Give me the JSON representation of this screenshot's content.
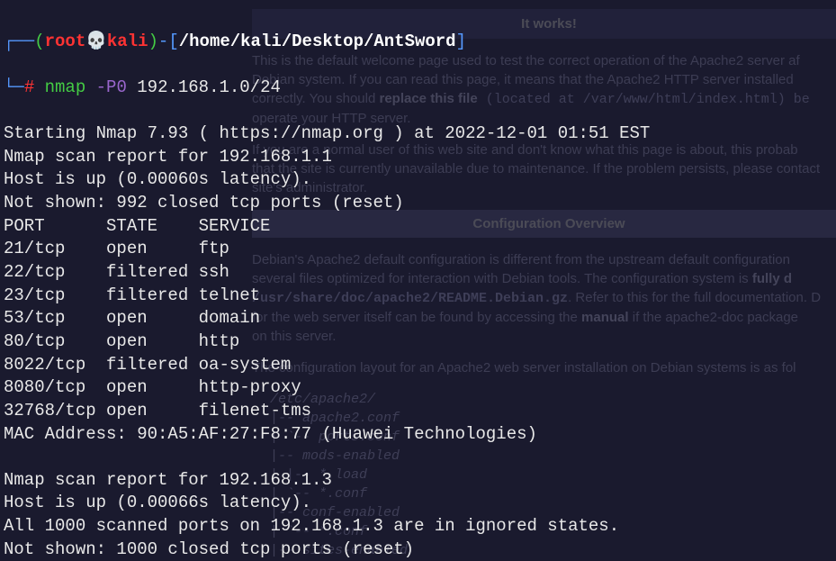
{
  "prompt": {
    "dash1": "┌──",
    "paren_open": "(",
    "root": "root",
    "skull": "💀",
    "host": "kali",
    "paren_close": ")",
    "dash2": "-",
    "bracket_open": "[",
    "path": "/home/kali/Desktop/AntSword",
    "bracket_close": "]",
    "line2_dash": "└─",
    "hash": "#",
    "cmd": "nmap",
    "flag": "-P0",
    "target": "192.168.1.0/24"
  },
  "output": {
    "l1": "Starting Nmap 7.93 ( https://nmap.org ) at 2022-12-01 01:51 EST",
    "l2": "Nmap scan report for 192.168.1.1",
    "l3": "Host is up (0.00060s latency).",
    "l4": "Not shown: 992 closed tcp ports (reset)",
    "l5": "PORT      STATE    SERVICE",
    "l6": "21/tcp    open     ftp",
    "l7": "22/tcp    filtered ssh",
    "l8": "23/tcp    filtered telnet",
    "l9": "53/tcp    open     domain",
    "l10": "80/tcp    open     http",
    "l11": "8022/tcp  filtered oa-system",
    "l12": "8080/tcp  open     http-proxy",
    "l13": "32768/tcp open     filenet-tms",
    "l14": "MAC Address: 90:A5:AF:27:F8:77 (Huawei Technologies)",
    "l15": "",
    "l16": "Nmap scan report for 192.168.1.3",
    "l17": "Host is up (0.00066s latency).",
    "l18": "All 1000 scanned ports on 192.168.1.3 are in ignored states.",
    "l19": "Not shown: 1000 closed tcp ports (reset)"
  },
  "bg": {
    "header": "It works!",
    "p1a": "This is the default welcome page used to test the correct operation of the Apache2 server af",
    "p1b": "Debian system. If you can read this page, it means that the Apache2 HTTP server installed",
    "p1c": "correctly. You should ",
    "p1bold": "replace this file",
    "p1d": " (located at /var/www/html/index.html) be",
    "p1e": "operate your HTTP server.",
    "p2a": "If you are a normal user of this web site and don't know what this page is about, this probab",
    "p2b": "that the site is currently unavailable due to maintenance. If the problem persists, please contact",
    "p2c": "site's administrator.",
    "conf_header": "Configuration Overview",
    "p3a": "Debian's Apache2 default configuration is different from the upstream default configuration",
    "p3b": "several files optimized for interaction with Debian tools. The configuration system is ",
    "p3bold": "fully d",
    "p3c": "/usr/share/doc/apache2/README.Debian.gz",
    "p3d": ". Refer to this for the full documentation. D",
    "p3e": "for the web server itself can be found by accessing the ",
    "p3bold2": "manual",
    "p3f": " if the apache2-doc package",
    "p3g": "on this server.",
    "p4": "The configuration layout for an Apache2 web server installation on Debian systems is as fol",
    "tree1": "/etc/apache2/",
    "tree2": "|-- apache2.conf",
    "tree3": "|       `-- ports.conf",
    "tree4": "|-- mods-enabled",
    "tree5": "|       |-- *.load",
    "tree6": "|       `-- *.conf",
    "tree7": "|-- conf-enabled",
    "tree8": "|       `-- *.conf",
    "tree9": "|-- sites-enabled"
  }
}
